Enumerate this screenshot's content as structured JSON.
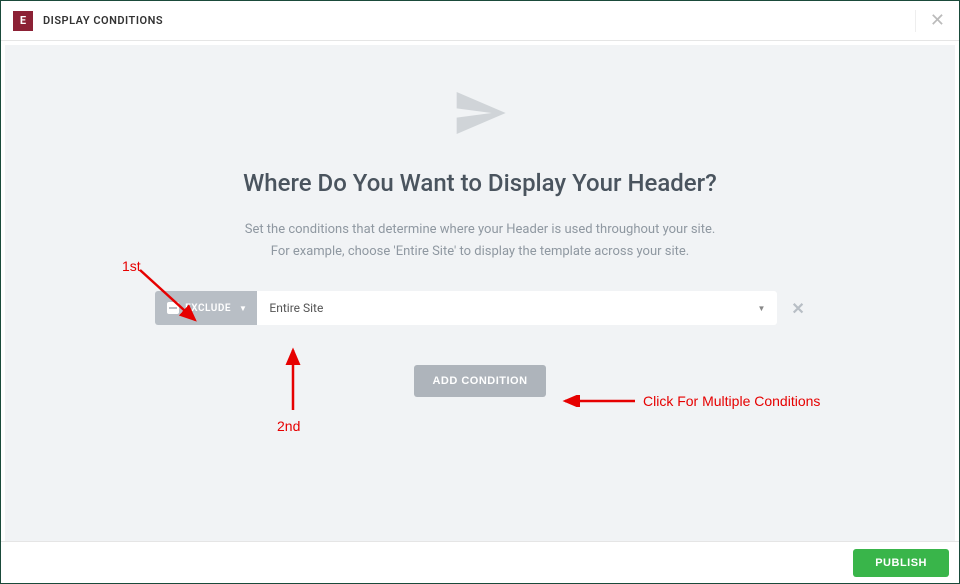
{
  "header": {
    "title": "DISPLAY CONDITIONS"
  },
  "main": {
    "heading": "Where Do You Want to Display Your Header?",
    "subtext_line1": "Set the conditions that determine where your Header is used throughout your site.",
    "subtext_line2": "For example, choose 'Entire Site' to display the template across your site."
  },
  "condition": {
    "type_label": "EXCLUDE",
    "scope_value": "Entire Site"
  },
  "buttons": {
    "add_condition": "ADD CONDITION",
    "publish": "PUBLISH"
  },
  "annotations": {
    "first": "1st",
    "second": "2nd",
    "click_multiple": "Click For Multiple Conditions"
  }
}
